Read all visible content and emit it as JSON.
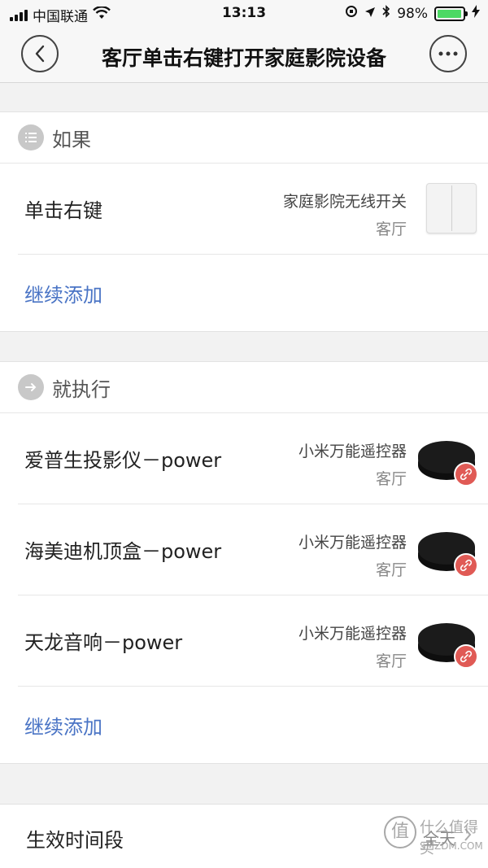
{
  "status_bar": {
    "carrier": "中国联通",
    "time": "13:13",
    "battery_percent": "98%",
    "battery_level": 0.98
  },
  "nav": {
    "title": "客厅单击右键打开家庭影院设备",
    "back_icon": "chevron-left-icon",
    "more_icon": "more-dots-icon"
  },
  "if_section": {
    "title": "如果",
    "icon": "list-icon",
    "rows": [
      {
        "label": "单击右键",
        "device": "家庭影院无线开关",
        "room": "客厅",
        "image": "wall-switch"
      }
    ],
    "add_label": "继续添加"
  },
  "then_section": {
    "title": "就执行",
    "icon": "arrow-right-icon",
    "rows": [
      {
        "label": "爱普生投影仪－power",
        "device": "小米万能遥控器",
        "room": "客厅",
        "image": "ir-remote"
      },
      {
        "label": "海美迪机顶盒－power",
        "device": "小米万能遥控器",
        "room": "客厅",
        "image": "ir-remote"
      },
      {
        "label": "天龙音响－power",
        "device": "小米万能遥控器",
        "room": "客厅",
        "image": "ir-remote"
      }
    ],
    "add_label": "继续添加"
  },
  "effective_time": {
    "label": "生效时间段",
    "value": "全天"
  },
  "watermark": {
    "logo_char": "值",
    "text": "什么值得买",
    "site": "SMZDM.COM"
  },
  "colors": {
    "accent_link": "#4a74c5",
    "battery_green": "#4cd964",
    "badge_red": "#e05a55"
  }
}
